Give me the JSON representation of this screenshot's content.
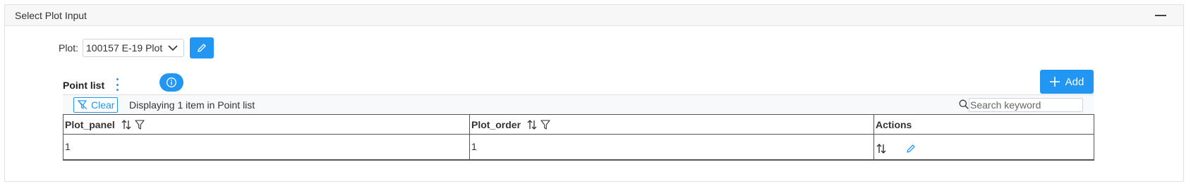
{
  "panel": {
    "title": "Select Plot Input"
  },
  "plot": {
    "label": "Plot:",
    "selected": "100157 E-19 Plot"
  },
  "point_list": {
    "title": "Point list",
    "add_label": "Add",
    "clear_label": "Clear",
    "display_text": "Displaying 1 item in Point list",
    "search_placeholder": "Search keyword",
    "columns": [
      "Plot_panel",
      "Plot_order",
      "Actions"
    ],
    "rows": [
      {
        "plot_panel": "1",
        "plot_order": "1"
      }
    ]
  },
  "colors": {
    "accent": "#2196f3",
    "header_bg": "#f7f7f7",
    "border": "#555555"
  }
}
